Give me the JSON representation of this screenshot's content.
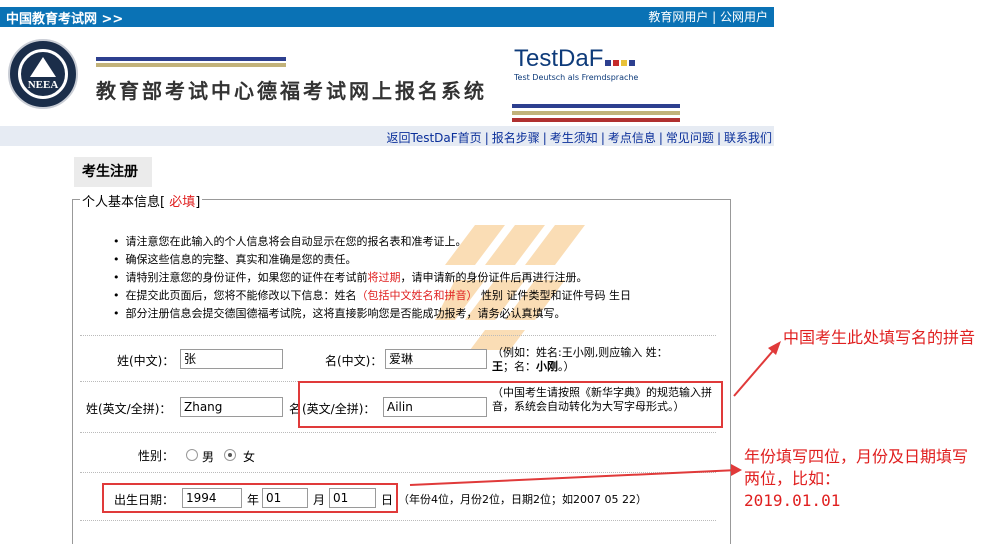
{
  "topbar": {
    "site_name": "中国教育考试网 >>",
    "users": "教育网用户 | 公网用户"
  },
  "banner": {
    "system_title": "教育部考试中心德福考试网上报名系统",
    "logo_text": "NEEA",
    "testdaf_title": "TestDaF",
    "testdaf_subtitle": "Test Deutsch als Fremdsprache"
  },
  "nav": {
    "items": [
      "返回TestDaF首页",
      "报名步骤",
      "考生须知",
      "考点信息",
      "常见问题",
      "联系我们"
    ]
  },
  "page": {
    "section_title": "考生注册",
    "legend_label": "个人基本信息[ ",
    "legend_required": "必填",
    "legend_close": "]"
  },
  "notes": {
    "n1": "请注意您在此输入的个人信息将会自动显示在您的报名表和准考证上。",
    "n2": "确保这些信息的完整、真实和准确是您的责任。",
    "n3a": "请特别注意您的身份证件，如果您的证件在考试前",
    "n3b": "将过期",
    "n3c": "，请申请新的身份证件后再进行注册。",
    "n4a": "在提交此页面后，您将不能修改以下信息：姓名",
    "n4b": "（包括中文姓名和拼音）",
    "n4c": " 性别 证件类型和证件号码 生日",
    "n5": "部分注册信息会提交德国德福考试院，这将直接影响您是否能成功报考，请务必认真填写。"
  },
  "form": {
    "surname_cn_label": "姓(中文)：",
    "surname_cn_value": "张",
    "given_cn_label": "名(中文)：",
    "given_cn_value": "爱琳",
    "cn_hint_a": "（例如：姓名:王小刚,则应输入 姓：",
    "cn_hint_b1": "王",
    "cn_hint_b2": "；名：",
    "cn_hint_b3": "小刚",
    "cn_hint_b4": "。）",
    "surname_en_label": "姓(英文/全拼)：",
    "surname_en_value": "Zhang",
    "given_en_label_a": "名",
    "given_en_label_b": "(英文/全拼)：",
    "given_en_value": "Ailin",
    "en_hint": "（中国考生请按照《新华字典》的规范输入拼音，系统会自动转化为大写字母形式。）",
    "gender_label": "性别：",
    "gender_male": "男",
    "gender_female": "女",
    "gender_selected": "女",
    "dob_label": "出生日期：",
    "dob_year": "1994",
    "dob_year_unit": "年",
    "dob_month": "01",
    "dob_month_unit": "月",
    "dob_day": "01",
    "dob_day_unit": "日",
    "dob_hint": "（年份4位，月份2位，日期2位；如2007 05 22）"
  },
  "annotations": {
    "pinyin_note": "中国考生此处填写名的拼音",
    "date_note_1": "年份填写四位，月份及日期填写两位，比如：",
    "date_note_2": "2019.01.01"
  },
  "colors": {
    "topbar": "#0a72b5",
    "nav_bg": "#e6ebf3",
    "annotation_red": "#e02020",
    "link_blue": "#0a2f9a"
  }
}
